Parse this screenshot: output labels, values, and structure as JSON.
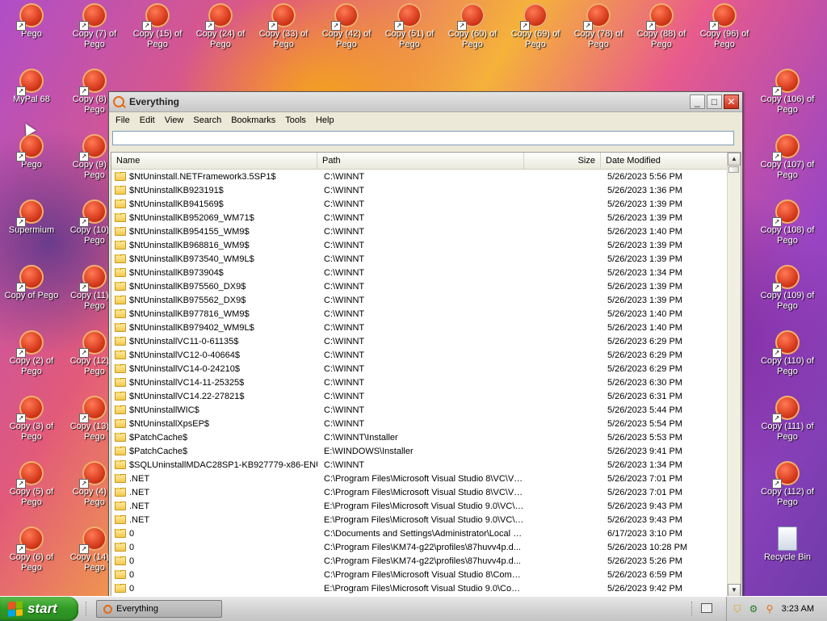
{
  "desktop": {
    "top_row": [
      "Pego",
      "Copy (7) of Pego",
      "Copy (15) of Pego",
      "Copy (24) of Pego",
      "Copy (33) of Pego",
      "Copy (42) of Pego",
      "Copy (51) of Pego",
      "Copy (60) of Pego",
      "Copy (69) of Pego",
      "Copy (78) of Pego",
      "Copy (88) of Pego",
      "Copy (96) of Pego"
    ],
    "col1": [
      "MyPal 68",
      "Pego",
      "Supermium",
      "Copy of Pego",
      "Copy (2) of Pego",
      "Copy (3) of Pego",
      "Copy (5) of Pego",
      "Copy (6) of Pego"
    ],
    "col2": [
      "Copy (8) of Pego",
      "Copy (9) of Pego",
      "Copy (10) of Pego",
      "Copy (11) of Pego",
      "Copy (12) of Pego",
      "Copy (13) of Pego",
      "Copy (4) of Pego",
      "Copy (14) of Pego"
    ],
    "right_col": [
      "Copy (106) of Pego",
      "Copy (107) of Pego",
      "Copy (108) of Pego",
      "Copy (109) of Pego",
      "Copy (110) of Pego",
      "Copy (111) of Pego",
      "Copy (112) of Pego",
      "Recycle Bin"
    ]
  },
  "window": {
    "title": "Everything",
    "menu": [
      "File",
      "Edit",
      "View",
      "Search",
      "Bookmarks",
      "Tools",
      "Help"
    ],
    "search": {
      "value": "",
      "placeholder": ""
    },
    "columns": {
      "name": "Name",
      "path": "Path",
      "size": "Size",
      "date": "Date Modified"
    },
    "rows": [
      {
        "name": "$NtUninstall.NETFramework3.5SP1$",
        "path": "C:\\WINNT",
        "size": "",
        "date": "5/26/2023 5:56 PM"
      },
      {
        "name": "$NtUninstallKB923191$",
        "path": "C:\\WINNT",
        "size": "",
        "date": "5/26/2023 1:36 PM"
      },
      {
        "name": "$NtUninstallKB941569$",
        "path": "C:\\WINNT",
        "size": "",
        "date": "5/26/2023 1:39 PM"
      },
      {
        "name": "$NtUninstallKB952069_WM71$",
        "path": "C:\\WINNT",
        "size": "",
        "date": "5/26/2023 1:39 PM"
      },
      {
        "name": "$NtUninstallKB954155_WM9$",
        "path": "C:\\WINNT",
        "size": "",
        "date": "5/26/2023 1:40 PM"
      },
      {
        "name": "$NtUninstallKB968816_WM9$",
        "path": "C:\\WINNT",
        "size": "",
        "date": "5/26/2023 1:39 PM"
      },
      {
        "name": "$NtUninstallKB973540_WM9L$",
        "path": "C:\\WINNT",
        "size": "",
        "date": "5/26/2023 1:39 PM"
      },
      {
        "name": "$NtUninstallKB973904$",
        "path": "C:\\WINNT",
        "size": "",
        "date": "5/26/2023 1:34 PM"
      },
      {
        "name": "$NtUninstallKB975560_DX9$",
        "path": "C:\\WINNT",
        "size": "",
        "date": "5/26/2023 1:39 PM"
      },
      {
        "name": "$NtUninstallKB975562_DX9$",
        "path": "C:\\WINNT",
        "size": "",
        "date": "5/26/2023 1:39 PM"
      },
      {
        "name": "$NtUninstallKB977816_WM9$",
        "path": "C:\\WINNT",
        "size": "",
        "date": "5/26/2023 1:40 PM"
      },
      {
        "name": "$NtUninstallKB979402_WM9L$",
        "path": "C:\\WINNT",
        "size": "",
        "date": "5/26/2023 1:40 PM"
      },
      {
        "name": "$NtUninstallVC11-0-61135$",
        "path": "C:\\WINNT",
        "size": "",
        "date": "5/26/2023 6:29 PM"
      },
      {
        "name": "$NtUninstallVC12-0-40664$",
        "path": "C:\\WINNT",
        "size": "",
        "date": "5/26/2023 6:29 PM"
      },
      {
        "name": "$NtUninstallVC14-0-24210$",
        "path": "C:\\WINNT",
        "size": "",
        "date": "5/26/2023 6:29 PM"
      },
      {
        "name": "$NtUninstallVC14-11-25325$",
        "path": "C:\\WINNT",
        "size": "",
        "date": "5/26/2023 6:30 PM"
      },
      {
        "name": "$NtUninstallVC14.22-27821$",
        "path": "C:\\WINNT",
        "size": "",
        "date": "5/26/2023 6:31 PM"
      },
      {
        "name": "$NtUninstallWIC$",
        "path": "C:\\WINNT",
        "size": "",
        "date": "5/26/2023 5:44 PM"
      },
      {
        "name": "$NtUninstallXpsEP$",
        "path": "C:\\WINNT",
        "size": "",
        "date": "5/26/2023 5:54 PM"
      },
      {
        "name": "$PatchCache$",
        "path": "C:\\WINNT\\Installer",
        "size": "",
        "date": "5/26/2023 5:53 PM"
      },
      {
        "name": "$PatchCache$",
        "path": "E:\\WINDOWS\\Installer",
        "size": "",
        "date": "5/26/2023 9:41 PM"
      },
      {
        "name": "$SQLUninstallMDAC28SP1-KB927779-x86-ENU$",
        "path": "C:\\WINNT",
        "size": "",
        "date": "5/26/2023 1:34 PM"
      },
      {
        "name": ".NET",
        "path": "C:\\Program Files\\Microsoft Visual Studio 8\\VC\\VC...",
        "size": "",
        "date": "5/26/2023 7:01 PM"
      },
      {
        "name": ".NET",
        "path": "C:\\Program Files\\Microsoft Visual Studio 8\\VC\\VC...",
        "size": "",
        "date": "5/26/2023 7:01 PM"
      },
      {
        "name": ".NET",
        "path": "E:\\Program Files\\Microsoft Visual Studio 9.0\\VC\\V...",
        "size": "",
        "date": "5/26/2023 9:43 PM"
      },
      {
        "name": ".NET",
        "path": "E:\\Program Files\\Microsoft Visual Studio 9.0\\VC\\V...",
        "size": "",
        "date": "5/26/2023 9:43 PM"
      },
      {
        "name": "0",
        "path": "C:\\Documents and Settings\\Administrator\\Local S...",
        "size": "",
        "date": "6/17/2023 3:10 PM"
      },
      {
        "name": "0",
        "path": "C:\\Program Files\\KM74-g22\\profiles\\87huvv4p.d...",
        "size": "",
        "date": "5/26/2023 10:28 PM"
      },
      {
        "name": "0",
        "path": "C:\\Program Files\\KM74-g22\\profiles\\87huvv4p.d...",
        "size": "",
        "date": "5/26/2023 5:26 PM"
      },
      {
        "name": "0",
        "path": "C:\\Program Files\\Microsoft Visual Studio 8\\Comm...",
        "size": "",
        "date": "5/26/2023 6:59 PM"
      },
      {
        "name": "0",
        "path": "E:\\Program Files\\Microsoft Visual Studio 9.0\\Com...",
        "size": "",
        "date": "5/26/2023 9:42 PM"
      }
    ]
  },
  "taskbar": {
    "start_label": "start",
    "task_label": "Everything",
    "clock": "3:23 AM"
  },
  "colors": {
    "start_green": "#2f9a25",
    "accent_orange": "#e46a14",
    "close_red": "#c8311a"
  },
  "icons": [
    "pego-icon",
    "shortcut-arrow-icon",
    "recycle-bin-icon",
    "everything-search-icon",
    "windows-flag-icon",
    "keyboard-icon",
    "shield-icon",
    "network-icon",
    "search-tray-icon"
  ]
}
